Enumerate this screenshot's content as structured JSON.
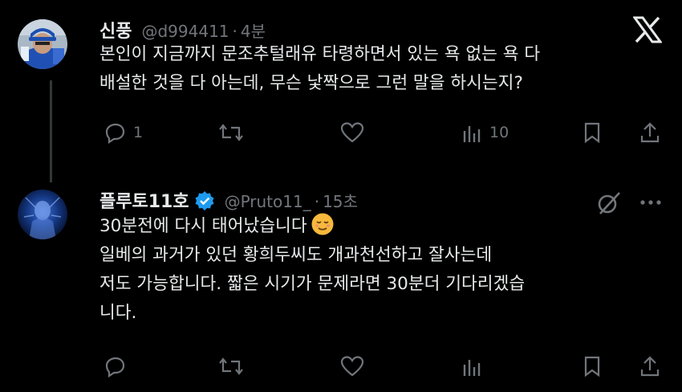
{
  "tweets": [
    {
      "name": "신풍",
      "handle": "@d994411",
      "separator": "·",
      "time": "4분",
      "lines": [
        "본인이 지금까지 문조추털래유 타령하면서 있는 욕 없는 욕 다",
        "배설한 것을 다 아는데, 무슨 낯짝으로 그런 말을 하시는지?"
      ],
      "reply_count": "1",
      "view_count": "10"
    },
    {
      "name": "플루토11호",
      "handle": "@Pruto11_",
      "separator": "·",
      "time": "15초",
      "lines": [
        "30분전에 다시 태어났습니다",
        "일베의 과거가 있던 황희두씨도 개과천선하고 잘사는데",
        "저도 가능합니다. 짧은 시기가 문제라면 30분더 기다리겠습",
        "니다."
      ],
      "emoji": "relieved-face",
      "verified": true
    }
  ],
  "colors": {
    "background": "#000000",
    "text": "#e7e9ea",
    "muted": "#71767b",
    "verified": "#1d9bf0",
    "emoji": "#f6b93b"
  },
  "icons": [
    "reply-icon",
    "retweet-icon",
    "like-icon",
    "views-icon",
    "bookmark-icon",
    "share-icon",
    "x-logo-icon",
    "grok-icon",
    "more-icon"
  ]
}
